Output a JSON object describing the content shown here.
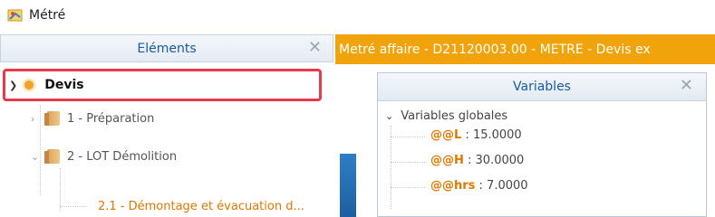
{
  "window": {
    "title": "Métré",
    "icon": "app-icon"
  },
  "left_panel": {
    "title": "Eléments",
    "close_icon": "close-icon",
    "tree": {
      "root": {
        "label": "Devis",
        "icon": "status-dot-icon"
      },
      "items": [
        {
          "label": "1 - Préparation",
          "expanded": false,
          "icon": "folder-icon"
        },
        {
          "label": "2 - LOT Démolition",
          "expanded": true,
          "icon": "folder-icon"
        }
      ],
      "leaf": {
        "label": "2.1 - Démontage et évacuation d..."
      }
    }
  },
  "right_panel": {
    "title": "Metré affaire - D21120003.00 - METRE - Devis ex",
    "colors": {
      "title_bg": "#f0a30a",
      "accent_text": "#e07800",
      "dialog_title": "#1a5aa6"
    }
  },
  "variables_dialog": {
    "title": "Variables",
    "close_icon": "close-icon",
    "group_label": "Variables globales",
    "variables": [
      {
        "name": "@@L",
        "value": " : 15.0000"
      },
      {
        "name": "@@H",
        "value": " : 30.0000"
      },
      {
        "name": "@@hrs",
        "value": " : 7.0000"
      }
    ]
  }
}
